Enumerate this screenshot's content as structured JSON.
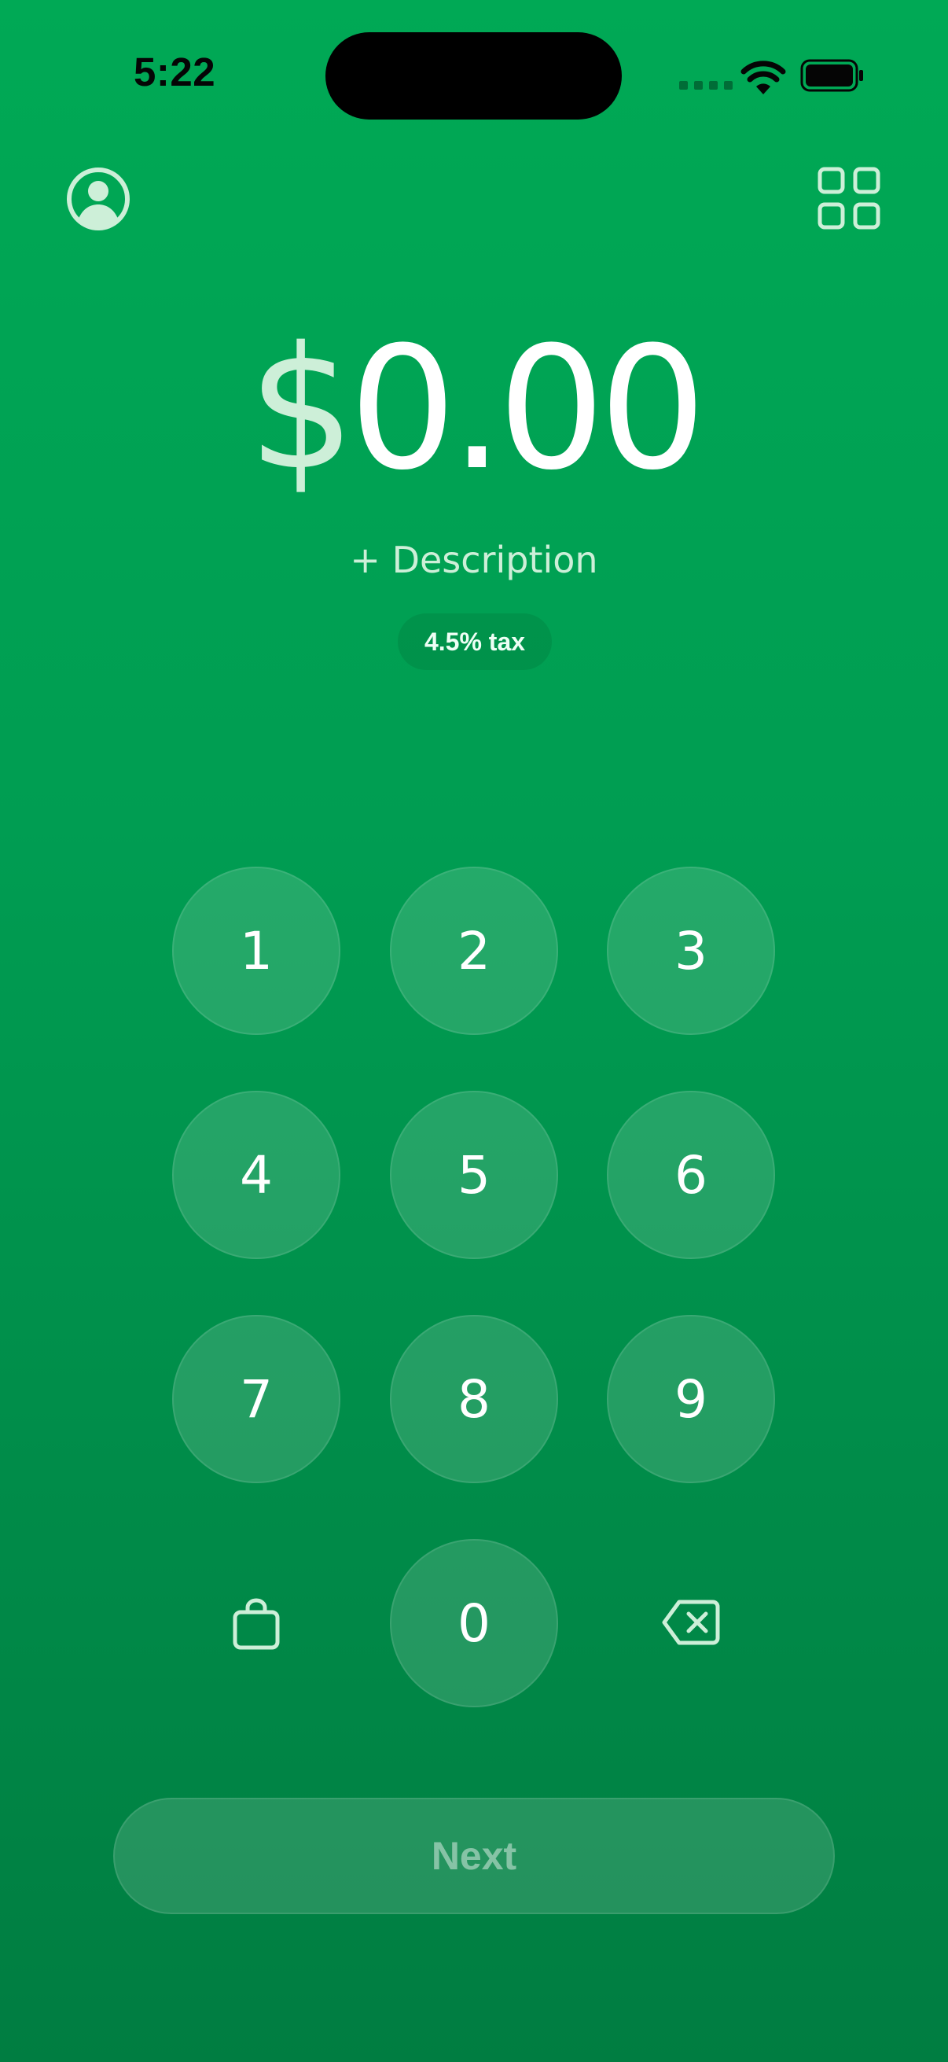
{
  "status_bar": {
    "time": "5:22"
  },
  "header": {
    "profile_icon": "person-circle-icon",
    "apps_icon": "grid-icon"
  },
  "amount": {
    "currency_symbol": "$",
    "value": "0.00"
  },
  "description": {
    "label": "+ Description"
  },
  "tax_badge": {
    "label": "4.5% tax"
  },
  "keypad": {
    "keys": [
      "1",
      "2",
      "3",
      "4",
      "5",
      "6",
      "7",
      "8",
      "9",
      "0"
    ],
    "bag_icon": "shopping-bag-icon",
    "backspace_icon": "backspace-icon"
  },
  "next_button": {
    "label": "Next"
  },
  "colors": {
    "background_top": "#00A955",
    "background_bottom": "#007D41",
    "currency_tint": "#CDEFD8"
  }
}
